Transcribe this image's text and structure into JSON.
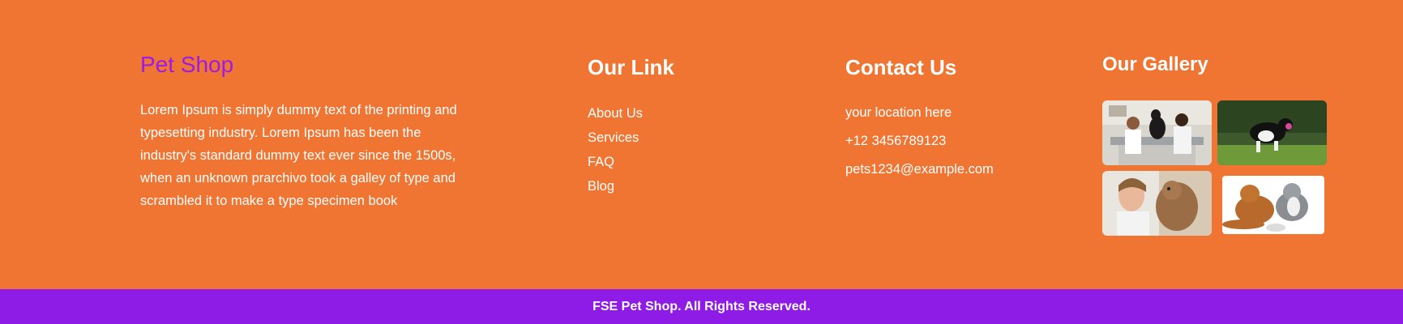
{
  "brand": {
    "name": "Pet Shop"
  },
  "about": {
    "text": "Lorem Ipsum is simply dummy text of the printing and typesetting industry. Lorem Ipsum has been the industry's standard dummy text ever since the 1500s, when an unknown prarchivo took a galley of type and scrambled it to make a type specimen book"
  },
  "links": {
    "heading": "Our Link",
    "items": [
      {
        "label": "About Us"
      },
      {
        "label": "Services"
      },
      {
        "label": "FAQ"
      },
      {
        "label": "Blog"
      }
    ]
  },
  "contact": {
    "heading": "Contact Us",
    "location": "your location here",
    "phone": "+12 3456789123",
    "email": "pets1234@example.com"
  },
  "gallery": {
    "heading": "Our Gallery",
    "images": [
      {
        "icon": "vet-clinic-photo"
      },
      {
        "icon": "dog-running-photo"
      },
      {
        "icon": "woman-with-dog-photo"
      },
      {
        "icon": "dog-and-cat-photo"
      }
    ]
  },
  "footer": {
    "copyright": "FSE Pet Shop. All Rights Reserved."
  },
  "colors": {
    "background": "#f07532",
    "brand": "#9a1ce6",
    "copyright_bar": "#8f1be6",
    "text": "#ffffff"
  }
}
